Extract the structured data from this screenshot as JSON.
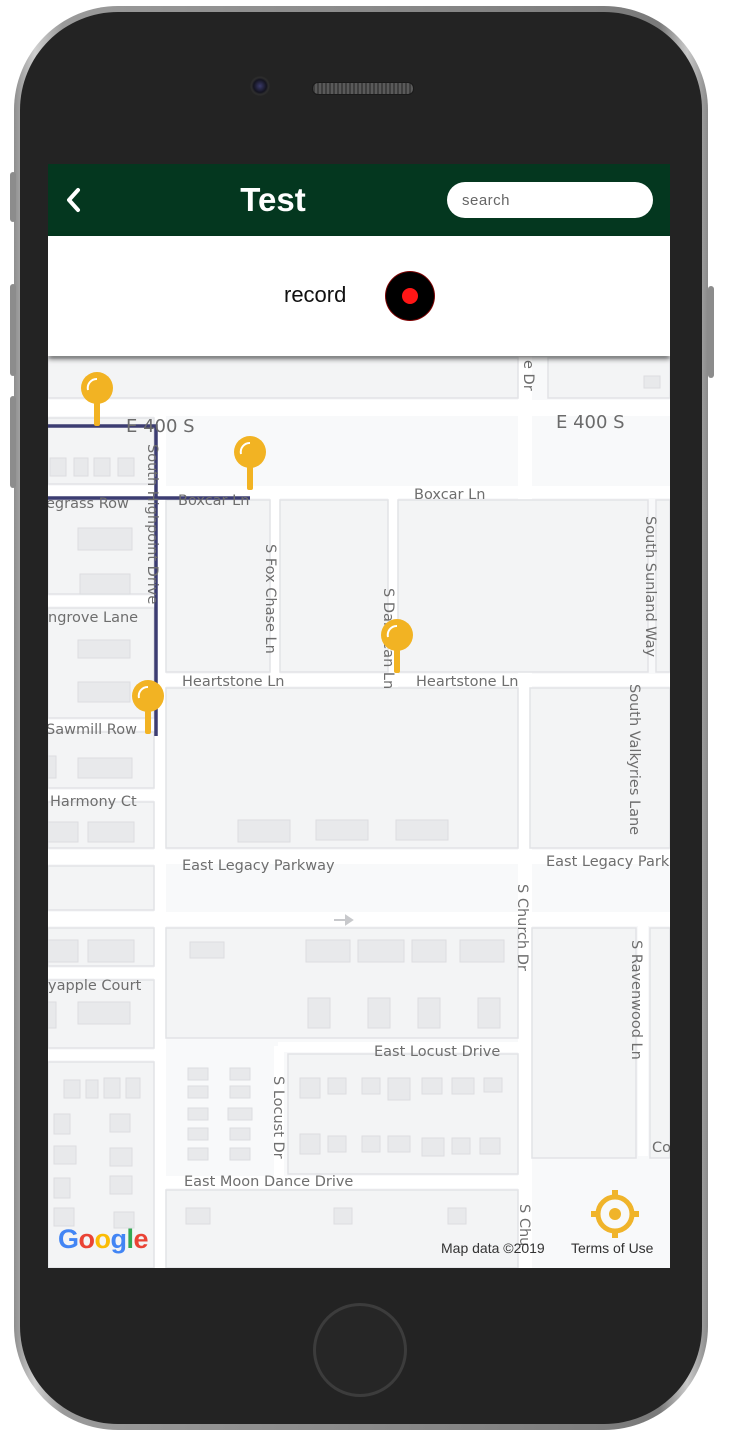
{
  "header": {
    "title": "Test",
    "search_placeholder": "search",
    "background_color": "#04371f"
  },
  "record": {
    "label": "record",
    "dot_color": "#ff1616"
  },
  "map": {
    "streets": {
      "e400s_left": "E 400 S",
      "e400s_right": "E 400 S",
      "boxcar_left": "Boxcar Ln",
      "boxcar_right": "Boxcar Ln",
      "bluegrass": "egrass Row",
      "highpoint": "South Highpoint Drive",
      "fox_chase": "S Fox Chase Ln",
      "sunland": "South Sunland Way",
      "danbean": "S Danbean Ln",
      "longrove": "ngrove Lane",
      "heartstone_left": "Heartstone Ln",
      "heartstone_right": "Heartstone Ln",
      "valkyries": "South Valkyries Lane",
      "sawmill": "Sawmill Row",
      "harmony": "Harmony Ct",
      "legacy_left": "East Legacy Parkway",
      "legacy_right": "East Legacy Park",
      "church": "S Church Dr",
      "ravenwood": "S Ravenwood Ln",
      "mayapple": "yapple Court",
      "locust_drive": "East Locust Drive",
      "locust_dr": "S Locust Dr",
      "moon_dance": "East Moon Dance Drive",
      "church_bottom": "S Chu",
      "top_drive": "e Dr",
      "co": "Co"
    },
    "marker_color": "#f2b323",
    "route_color": "#3c3d72"
  },
  "footer": {
    "logo": [
      "G",
      "o",
      "o",
      "g",
      "l",
      "e"
    ],
    "logo_colors": [
      "#4285F4",
      "#EA4335",
      "#FBBC05",
      "#4285F4",
      "#34A853",
      "#EA4335"
    ],
    "map_data": "Map data ©2019",
    "terms": "Terms of Use",
    "locate_color": "#f0b42a"
  }
}
